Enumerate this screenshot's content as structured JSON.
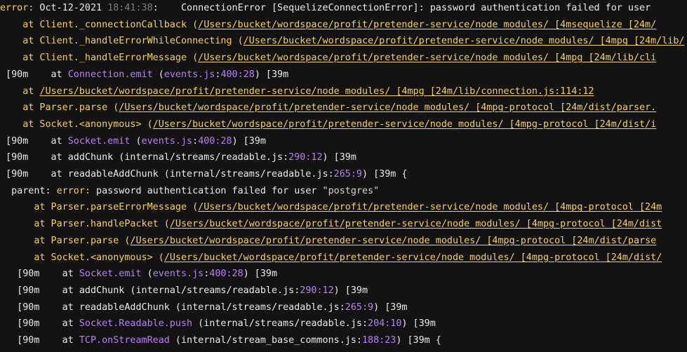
{
  "terminal": {
    "lines": [
      {
        "indent": "",
        "segments": [
          {
            "t": "error:",
            "c": "y"
          },
          {
            "t": " Oct-12-2021 ",
            "c": "w"
          },
          {
            "t": "18:41:38",
            "c": "g"
          },
          {
            "t": ":    ConnectionError [SequelizeConnectionError]: password authentication failed for user",
            "c": "w"
          }
        ]
      },
      {
        "indent": "    ",
        "segments": [
          {
            "t": "at Client._connectionCallback (",
            "c": "y"
          },
          {
            "t": "/Users/bucket/wordspace/profit/pretender-service/node_modules/ [4msequelize [24m/",
            "c": "yu"
          }
        ]
      },
      {
        "indent": "    ",
        "segments": [
          {
            "t": "at Client._handleErrorWhileConnecting (",
            "c": "y"
          },
          {
            "t": "/Users/bucket/wordspace/profit/pretender-service/node_modules/ [4mpg [24m/lib/",
            "c": "yu"
          }
        ]
      },
      {
        "indent": "    ",
        "segments": [
          {
            "t": "at Client._handleErrorMessage (",
            "c": "y"
          },
          {
            "t": "/Users/bucket/wordspace/profit/pretender-service/node_modules/ [4mpg [24m/lib/cli",
            "c": "yu"
          }
        ]
      },
      {
        "indent": " ",
        "segments": [
          {
            "t": "[90m    at ",
            "c": "w"
          },
          {
            "t": "Connection.emit",
            "c": "p"
          },
          {
            "t": " (",
            "c": "w"
          },
          {
            "t": "events.js",
            "c": "p"
          },
          {
            "t": ":",
            "c": "w"
          },
          {
            "t": "400:28",
            "c": "p"
          },
          {
            "t": ") [39m",
            "c": "w"
          }
        ]
      },
      {
        "indent": "    ",
        "segments": [
          {
            "t": "at ",
            "c": "y"
          },
          {
            "t": "/Users/bucket/wordspace/profit/pretender-service/node_modules/ [4mpg [24m/lib/connection.js:114:12",
            "c": "yu"
          }
        ]
      },
      {
        "indent": "    ",
        "segments": [
          {
            "t": "at Parser.parse (",
            "c": "y"
          },
          {
            "t": "/Users/bucket/wordspace/profit/pretender-service/node_modules/ [4mpg-protocol [24m/dist/parser.",
            "c": "yu"
          }
        ]
      },
      {
        "indent": "    ",
        "segments": [
          {
            "t": "at Socket.<anonymous> (",
            "c": "y"
          },
          {
            "t": "/Users/bucket/wordspace/profit/pretender-service/node_modules/ [4mpg-protocol [24m/dist/i",
            "c": "yu"
          }
        ]
      },
      {
        "indent": " ",
        "segments": [
          {
            "t": "[90m    at ",
            "c": "w"
          },
          {
            "t": "Socket.emit",
            "c": "p"
          },
          {
            "t": " (",
            "c": "w"
          },
          {
            "t": "events.js",
            "c": "p"
          },
          {
            "t": ":",
            "c": "w"
          },
          {
            "t": "400:28",
            "c": "p"
          },
          {
            "t": ") [39m",
            "c": "w"
          }
        ]
      },
      {
        "indent": " ",
        "segments": [
          {
            "t": "[90m    at addChunk (internal/streams/readable.js:",
            "c": "w"
          },
          {
            "t": "290:12",
            "c": "p"
          },
          {
            "t": ") [39m",
            "c": "w"
          }
        ]
      },
      {
        "indent": " ",
        "segments": [
          {
            "t": "[90m    at readableAddChunk (internal/streams/readable.js:",
            "c": "w"
          },
          {
            "t": "265:9",
            "c": "p"
          },
          {
            "t": ") [39m {",
            "c": "w"
          }
        ]
      },
      {
        "indent": "  ",
        "segments": [
          {
            "t": "parent: ",
            "c": "w"
          },
          {
            "t": "error:",
            "c": "y"
          },
          {
            "t": " password authentication failed for user ",
            "c": "w"
          },
          {
            "t": "\"postgres\"",
            "c": "s"
          }
        ]
      },
      {
        "indent": "      ",
        "segments": [
          {
            "t": "at Parser.parseErrorMessage (",
            "c": "y"
          },
          {
            "t": "/Users/bucket/wordspace/profit/pretender-service/node_modules/ [4mpg-protocol [24m",
            "c": "yu"
          }
        ]
      },
      {
        "indent": "      ",
        "segments": [
          {
            "t": "at Parser.handlePacket (",
            "c": "y"
          },
          {
            "t": "/Users/bucket/wordspace/profit/pretender-service/node_modules/ [4mpg-protocol [24m/dist",
            "c": "yu"
          }
        ]
      },
      {
        "indent": "      ",
        "segments": [
          {
            "t": "at Parser.parse (",
            "c": "y"
          },
          {
            "t": "/Users/bucket/wordspace/profit/pretender-service/node_modules/ [4mpg-protocol [24m/dist/parse",
            "c": "yu"
          }
        ]
      },
      {
        "indent": "      ",
        "segments": [
          {
            "t": "at Socket.<anonymous> (",
            "c": "y"
          },
          {
            "t": "/Users/bucket/wordspace/profit/pretender-service/node_modules/ [4mpg-protocol [24m/dist/",
            "c": "yu"
          }
        ]
      },
      {
        "indent": "   ",
        "segments": [
          {
            "t": "[90m    at ",
            "c": "w"
          },
          {
            "t": "Socket.emit",
            "c": "p"
          },
          {
            "t": " (",
            "c": "w"
          },
          {
            "t": "events.js",
            "c": "p"
          },
          {
            "t": ":",
            "c": "w"
          },
          {
            "t": "400:28",
            "c": "p"
          },
          {
            "t": ") [39m",
            "c": "w"
          }
        ]
      },
      {
        "indent": "   ",
        "segments": [
          {
            "t": "[90m    at addChunk (internal/streams/readable.js:",
            "c": "w"
          },
          {
            "t": "290:12",
            "c": "p"
          },
          {
            "t": ") [39m",
            "c": "w"
          }
        ]
      },
      {
        "indent": "   ",
        "segments": [
          {
            "t": "[90m    at readableAddChunk (internal/streams/readable.js:",
            "c": "w"
          },
          {
            "t": "265:9",
            "c": "p"
          },
          {
            "t": ") [39m",
            "c": "w"
          }
        ]
      },
      {
        "indent": "   ",
        "segments": [
          {
            "t": "[90m    at ",
            "c": "w"
          },
          {
            "t": "Socket.Readable.push",
            "c": "p"
          },
          {
            "t": " (internal/streams/readable.js:",
            "c": "w"
          },
          {
            "t": "204:10",
            "c": "p"
          },
          {
            "t": ") [39m",
            "c": "w"
          }
        ]
      },
      {
        "indent": "   ",
        "segments": [
          {
            "t": "[90m    at ",
            "c": "w"
          },
          {
            "t": "TCP.onStreamRead",
            "c": "p"
          },
          {
            "t": " (internal/stream_base_commons.js:",
            "c": "w"
          },
          {
            "t": "188:23",
            "c": "p"
          },
          {
            "t": ") [39m {",
            "c": "w"
          }
        ]
      }
    ]
  }
}
